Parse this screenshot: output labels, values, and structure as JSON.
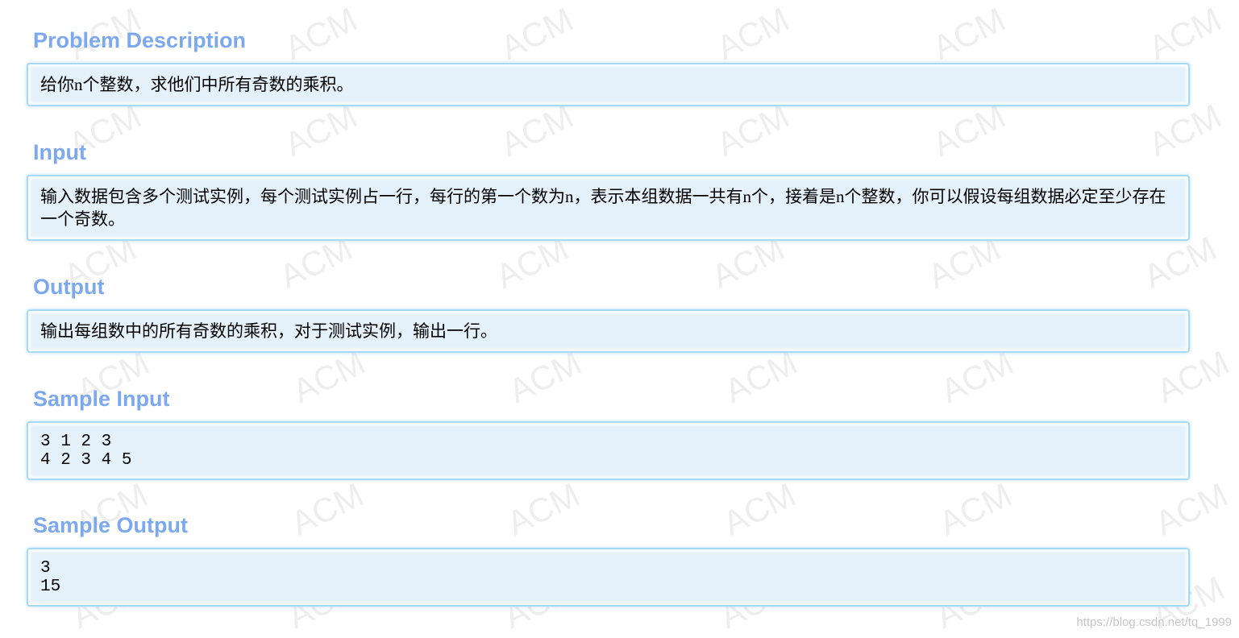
{
  "watermark": {
    "text": "ACM",
    "csdn_mark": "https://blog.csdn.net/tq_1999"
  },
  "sections": {
    "description": {
      "title": "Problem Description",
      "lines": [
        "给你n个整数，求他们中所有奇数的乘积。"
      ]
    },
    "input": {
      "title": "Input",
      "lines": [
        "输入数据包含多个测试实例，每个测试实例占一行，每行的第一个数为n，表示本组数据一共有n个，接着是n个整数，你可以假设每组数据必定至少存在",
        "一个奇数。"
      ]
    },
    "output": {
      "title": "Output",
      "lines": [
        "输出每组数中的所有奇数的乘积，对于测试实例，输出一行。"
      ]
    },
    "sample_input": {
      "title": "Sample Input",
      "lines": [
        "3 1 2 3",
        "4 2 3 4 5"
      ]
    },
    "sample_output": {
      "title": "Sample Output",
      "lines": [
        "3",
        "15"
      ]
    }
  },
  "colors": {
    "title": "#7CA9ED",
    "panel_border": "#A6DAF7",
    "panel_fill": "#E4F0FA",
    "text": "#000000",
    "watermark": "#EEEEEE",
    "csdn_watermark": "#C6C6C6"
  }
}
